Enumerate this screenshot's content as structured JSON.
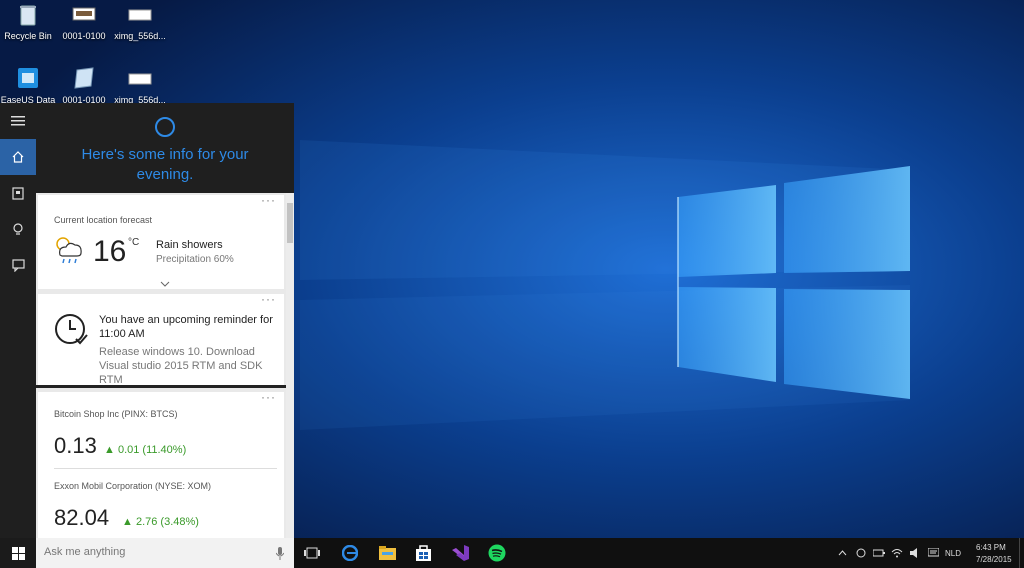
{
  "desktop": {
    "icons": [
      {
        "label": "Recycle Bin"
      },
      {
        "label": "0001-0100"
      },
      {
        "label": "ximg_556d..."
      },
      {
        "label": "EaseUS Data"
      },
      {
        "label": "0001-0100"
      },
      {
        "label": "ximg_556d..."
      }
    ]
  },
  "cortana": {
    "greeting": "Here's some info for your evening.",
    "weather": {
      "title": "Current location forecast",
      "temperature": "16",
      "unit": "°C",
      "condition": "Rain showers",
      "precipitation": "Precipitation 60%"
    },
    "reminder": {
      "title": "You have an upcoming reminder for 11:00 AM",
      "detail": "Release windows 10. Download Visual studio 2015 RTM and SDK RTM"
    },
    "stocks": [
      {
        "name": "Bitcoin Shop Inc (PINX: BTCS)",
        "price": "0.13",
        "change": "0.01 (11.40%)"
      },
      {
        "name": "Exxon Mobil Corporation (NYSE: XOM)",
        "price": "82.04",
        "change": "2.76 (3.48%)"
      }
    ],
    "more_label": "···"
  },
  "taskbar": {
    "search_placeholder": "Ask me anything",
    "language": "NLD",
    "time": "6:43 PM",
    "date": "7/28/2015"
  },
  "colors": {
    "accent": "#2e8ae6",
    "rail_active": "#2b63a6",
    "stock_up": "#3a9a2a"
  }
}
